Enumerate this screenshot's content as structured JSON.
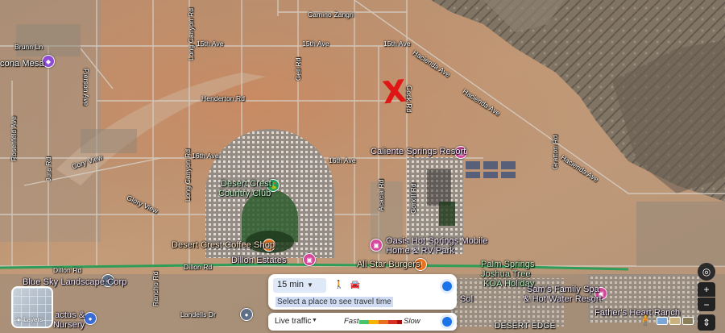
{
  "map": {
    "roads": {
      "camino_zangri": "Camino Zangri",
      "ave_15th_left": "15th Ave",
      "ave_15th_mid": "15th Ave",
      "ave_15th_right": "15th Ave",
      "henderton": "Henderton Rd",
      "ave_16th_left": "16th Ave",
      "ave_16th_mid": "16th Ave",
      "long_canyon_top": "Long Canyon Rd",
      "long_canyon_mid": "Long Canyon Rd",
      "cell_rd": "Cell Rd",
      "cock_rd": "Cock Rd",
      "corkill_rd": "Corkill Rd",
      "acacia_rd": "Acacia Rd",
      "hacienda_top": "Hacienda Ave",
      "hacienda_mid": "Hacienda Ave",
      "hacienda_low": "Hacienda Ave",
      "gratton_rd": "Gratton Rd",
      "cory_view": "Cory View",
      "glory_view": "Glory View",
      "jura_rd": "Jura Rd",
      "rosenfeld": "Rosenfeld Ave",
      "pierson": "Pierson Ave",
      "brunn_ln": "Brunn Ln",
      "dillon_left": "Dillon Rd",
      "dillon_mid": "Dillon Rd",
      "rancho_rd": "Rancho Rd",
      "landells": "Landells Dr"
    },
    "places": {
      "acona_mesa": "cona Mesa",
      "caliente": "Caliente Springs Resort",
      "desert_crest_cc_1": "Desert Crest",
      "desert_crest_cc_2": "Country Club",
      "desert_crest_coffee": "Desert Crest Coffee Shop",
      "dillon_estates": "Dillon Estates",
      "oasis_1": "Oasis Hot Springs Mobile",
      "oasis_2": "Home & RV Park",
      "all_star": "All Star Burgers",
      "palm_springs_1": "Palm Springs",
      "palm_springs_2": "Joshua Tree",
      "palm_springs_3": "KOA Holiday",
      "sam_spa_1": "Sam's Family Spa",
      "sam_spa_2": "& Hot Water Resort",
      "fathers_heart": "Father's Heart Ranch",
      "blue_sky": "Blue Sky Landscape Corp",
      "cactus_1": "actus &",
      "cactus_2": "Nursery",
      "sol": "Sol",
      "desert_edge": "DESERT EDGE"
    },
    "annotation": "X"
  },
  "layers": {
    "label": "Layers"
  },
  "travel": {
    "time_value": "15 min",
    "hint": "Select a place to see travel time"
  },
  "traffic": {
    "label": "Live traffic",
    "fast": "Fast",
    "slow": "Slow",
    "colors": [
      "#47c46b",
      "#f4b400",
      "#e8711f",
      "#d93025",
      "#a50e0e"
    ]
  },
  "controls": {
    "locate_icon": "locate-icon",
    "zoom_in": "+",
    "zoom_out": "−",
    "expand": "⇕"
  }
}
